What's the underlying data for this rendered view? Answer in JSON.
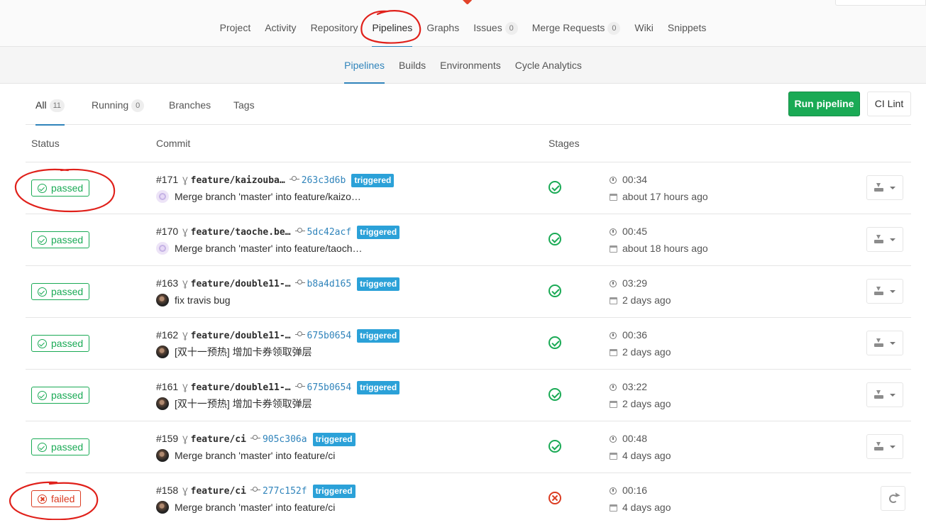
{
  "nav": {
    "items": [
      {
        "label": "Project"
      },
      {
        "label": "Activity"
      },
      {
        "label": "Repository"
      },
      {
        "label": "Pipelines"
      },
      {
        "label": "Graphs"
      },
      {
        "label": "Issues",
        "count": "0"
      },
      {
        "label": "Merge Requests",
        "count": "0"
      },
      {
        "label": "Wiki"
      },
      {
        "label": "Snippets"
      }
    ],
    "active": "Pipelines"
  },
  "subnav": {
    "items": [
      {
        "label": "Pipelines"
      },
      {
        "label": "Builds"
      },
      {
        "label": "Environments"
      },
      {
        "label": "Cycle Analytics"
      }
    ]
  },
  "scopes": {
    "all": {
      "label": "All",
      "count": "11"
    },
    "running": {
      "label": "Running",
      "count": "0"
    },
    "branches": {
      "label": "Branches"
    },
    "tags": {
      "label": "Tags"
    }
  },
  "actions": {
    "run_pipeline": "Run pipeline",
    "ci_lint": "CI Lint"
  },
  "table": {
    "headers": {
      "status": "Status",
      "commit": "Commit",
      "stages": "Stages"
    }
  },
  "colors": {
    "success": "#1aaa55",
    "failed": "#db3b21",
    "link": "#3084bb",
    "annotation": "#e0211b"
  },
  "pipelines": [
    {
      "id": "#171",
      "branch": "feature/kaizouba…",
      "sha": "263c3d6b",
      "tag": "triggered",
      "avatar": "pattern",
      "message": "Merge branch 'master' into feature/kaizo…",
      "status": "passed",
      "stage": "success",
      "duration": "00:34",
      "finished": "about 17 hours ago",
      "action": "download"
    },
    {
      "id": "#170",
      "branch": "feature/taoche.be…",
      "sha": "5dc42acf",
      "tag": "triggered",
      "avatar": "pattern",
      "message": "Merge branch 'master' into feature/taoch…",
      "status": "passed",
      "stage": "success",
      "duration": "00:45",
      "finished": "about 18 hours ago",
      "action": "download"
    },
    {
      "id": "#163",
      "branch": "feature/double11-…",
      "sha": "b8a4d165",
      "tag": "triggered",
      "avatar": "photo",
      "message": "fix travis bug",
      "status": "passed",
      "stage": "success",
      "duration": "03:29",
      "finished": "2 days ago",
      "action": "download"
    },
    {
      "id": "#162",
      "branch": "feature/double11-…",
      "sha": "675b0654",
      "tag": "triggered",
      "avatar": "photo",
      "message": "[双十一预热] 增加卡券领取弹层",
      "status": "passed",
      "stage": "success",
      "duration": "00:36",
      "finished": "2 days ago",
      "action": "download"
    },
    {
      "id": "#161",
      "branch": "feature/double11-…",
      "sha": "675b0654",
      "tag": "triggered",
      "avatar": "photo",
      "message": "[双十一预热] 增加卡券领取弹层",
      "status": "passed",
      "stage": "success",
      "duration": "03:22",
      "finished": "2 days ago",
      "action": "download"
    },
    {
      "id": "#159",
      "branch": "feature/ci",
      "sha": "905c306a",
      "tag": "triggered",
      "avatar": "photo",
      "message": "Merge branch 'master' into feature/ci",
      "status": "passed",
      "stage": "success",
      "duration": "00:48",
      "finished": "4 days ago",
      "action": "download"
    },
    {
      "id": "#158",
      "branch": "feature/ci",
      "sha": "277c152f",
      "tag": "triggered",
      "avatar": "photo",
      "message": "Merge branch 'master' into feature/ci",
      "status": "failed",
      "stage": "failed",
      "duration": "00:16",
      "finished": "4 days ago",
      "action": "retry"
    }
  ]
}
